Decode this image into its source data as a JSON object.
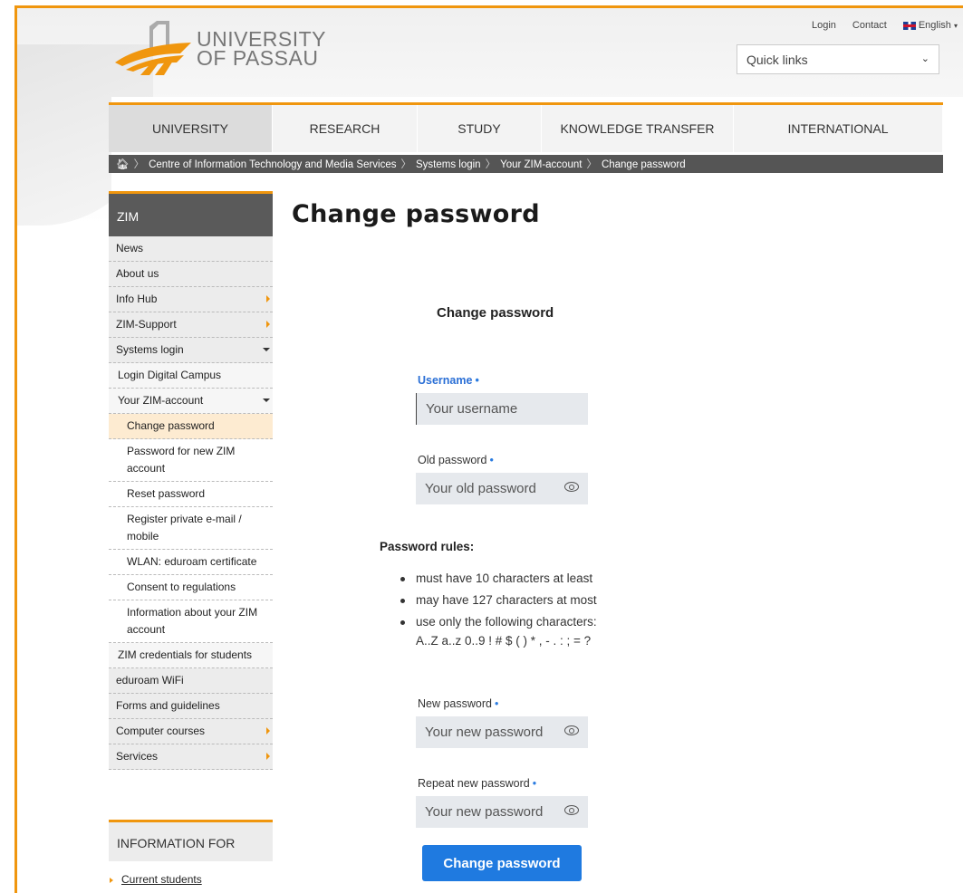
{
  "header": {
    "logo_line1": "UNIVERSITY",
    "logo_line2": "OF PASSAU",
    "login": "Login",
    "contact": "Contact",
    "language": "English",
    "quick_links": "Quick links"
  },
  "nav": [
    "UNIVERSITY",
    "RESEARCH",
    "STUDY",
    "KNOWLEDGE TRANSFER",
    "INTERNATIONAL"
  ],
  "breadcrumb": [
    "Centre of Information Technology and Media Services",
    "Systems login",
    "Your ZIM-account",
    "Change password"
  ],
  "sidebar": {
    "title": "ZIM",
    "items": [
      {
        "label": "News"
      },
      {
        "label": "About us"
      },
      {
        "label": "Info Hub"
      },
      {
        "label": "ZIM-Support"
      },
      {
        "label": "Systems login"
      },
      {
        "label": "Login Digital Campus"
      },
      {
        "label": "Your ZIM-account"
      },
      {
        "label": "Change password"
      },
      {
        "label": "Password for new ZIM account"
      },
      {
        "label": "Reset password"
      },
      {
        "label": "Register private e-mail / mobile"
      },
      {
        "label": "WLAN: eduroam certificate"
      },
      {
        "label": "Consent to regulations"
      },
      {
        "label": "Information about your ZIM account"
      },
      {
        "label": "ZIM credentials for students"
      },
      {
        "label": "eduroam WiFi"
      },
      {
        "label": "Forms and guidelines"
      },
      {
        "label": "Computer courses"
      },
      {
        "label": "Services"
      }
    ],
    "info_for": "INFORMATION FOR",
    "current_students": "Current students"
  },
  "main": {
    "title": "Change password",
    "form_title": "Change password",
    "username_label": "Username",
    "username_placeholder": "Your username",
    "old_label": "Old password",
    "old_placeholder": "Your old password",
    "rules_title": "Password rules:",
    "rules": [
      "must have 10 characters at least",
      "may have 127 characters at most",
      "use only the following characters:"
    ],
    "charset": "A..Z a..z 0..9 ! # $ ( ) * , - . : ; = ?",
    "new_label": "New password",
    "new_placeholder": "Your new password",
    "repeat_label": "Repeat new password",
    "repeat_placeholder": "Your new password",
    "submit": "Change password",
    "required_mark": "•"
  }
}
